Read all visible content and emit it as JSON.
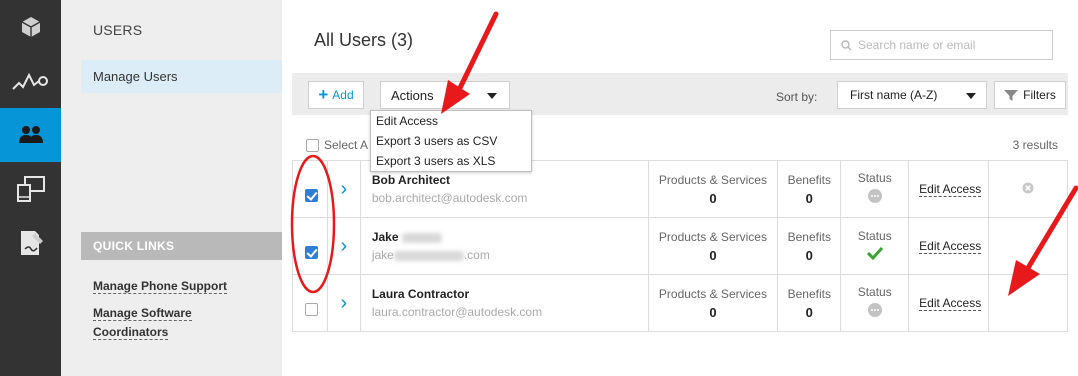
{
  "nav": {
    "title": "USERS",
    "item_manage_users": "Manage Users",
    "quick_links_title": "QUICK LINKS",
    "links": [
      "Manage Phone Support",
      "Manage Software",
      "Coordinators"
    ]
  },
  "main": {
    "title": "All Users (3)",
    "search_placeholder": "Search name or email",
    "toolbar": {
      "add_label": "Add",
      "actions_label": "Actions",
      "sort_by_label": "Sort by:",
      "sort_value": "First name (A-Z)",
      "filters_label": "Filters"
    },
    "actions_menu": [
      "Edit Access",
      "Export 3 users as CSV",
      "Export 3 users as XLS"
    ],
    "select_all_label": "Select A",
    "results_count": "3 results",
    "column_labels": {
      "products": "Products & Services",
      "benefits": "Benefits",
      "status": "Status",
      "edit_access": "Edit Access"
    },
    "users": [
      {
        "name": "Bob Architect",
        "email": "bob.architect@autodesk.com",
        "products": "0",
        "benefits": "0",
        "status": "inactive",
        "checked": true
      },
      {
        "name": "Jake",
        "email_prefix": "jake",
        "email_suffix": ".com",
        "products": "0",
        "benefits": "0",
        "status": "active",
        "checked": true
      },
      {
        "name": "Laura Contractor",
        "email": "laura.contractor@autodesk.com",
        "products": "0",
        "benefits": "0",
        "status": "inactive",
        "checked": false
      }
    ]
  },
  "colors": {
    "accent": "#0696d7",
    "rail": "#333333",
    "annotation_red": "#e8191b",
    "status_active": "#3aa431"
  },
  "icons": [
    "cube-icon",
    "analytics-icon",
    "users-icon",
    "devices-icon",
    "document-icon",
    "search-icon",
    "filter-icon",
    "chevron-right-icon",
    "check-icon",
    "status-dot-icon",
    "remove-icon"
  ]
}
